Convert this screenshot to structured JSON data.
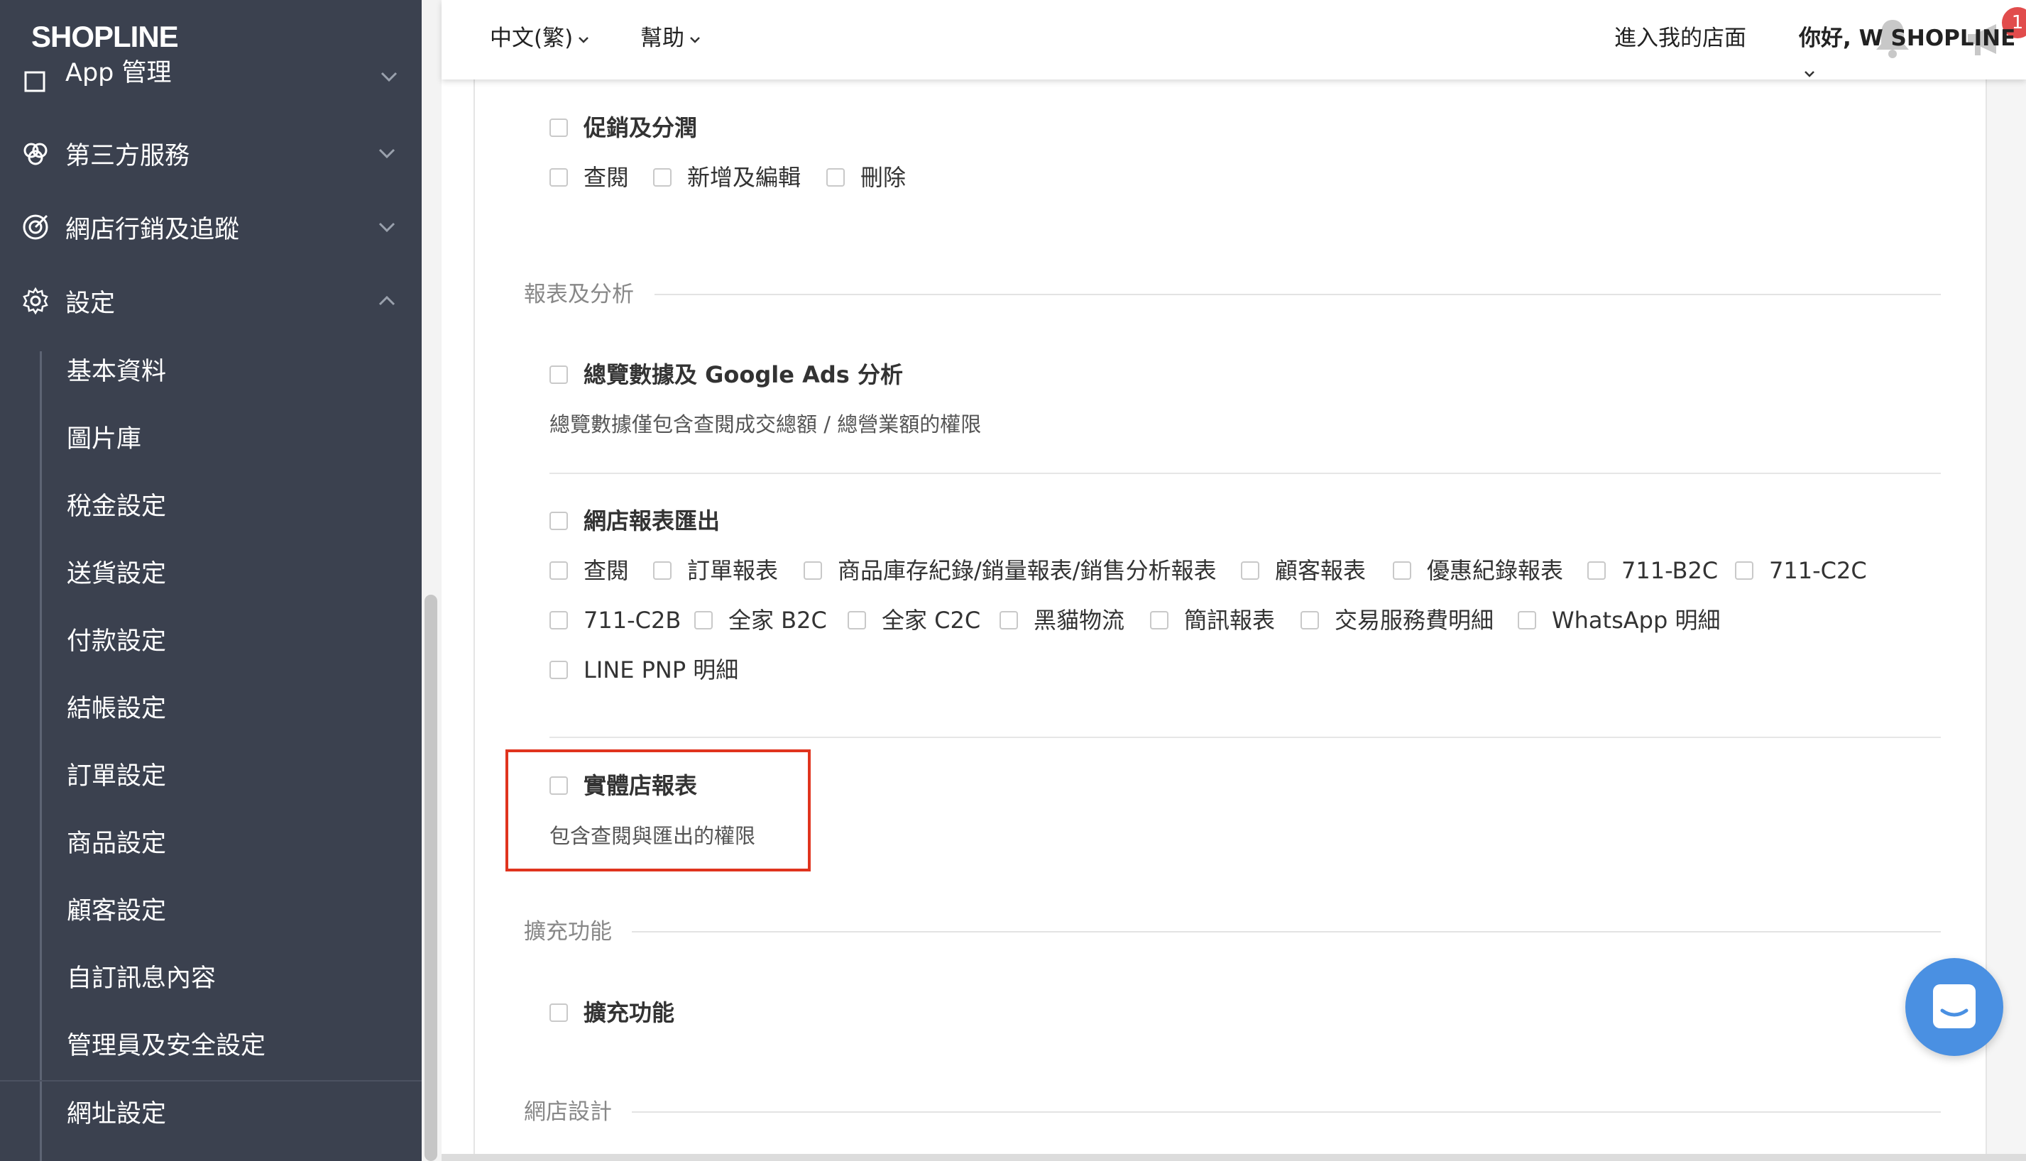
{
  "sidebar": {
    "logo": "SHOPLINE",
    "top_partial_item": "App 管理",
    "items": [
      {
        "label": "第三方服務",
        "icon": "puzzle-icon",
        "expanded": false
      },
      {
        "label": "網店行銷及追蹤",
        "icon": "target-icon",
        "expanded": false
      },
      {
        "label": "設定",
        "icon": "gear-icon",
        "expanded": true
      }
    ],
    "settings_sub_items": [
      "基本資料",
      "圖片庫",
      "稅金設定",
      "送貨設定",
      "付款設定",
      "結帳設定",
      "訂單設定",
      "商品設定",
      "顧客設定",
      "自訂訊息內容",
      "管理員及安全設定",
      "網址設定"
    ]
  },
  "topbar": {
    "language": "中文(繁)",
    "help": "幫助",
    "notification_badge": "1",
    "enter_store": "進入我的店面",
    "greeting": "你好, W SHOPLINE"
  },
  "permissions": {
    "promotions": {
      "title": "促銷及分潤",
      "options": [
        "查閱",
        "新增及編輯",
        "刪除"
      ]
    },
    "reports_section_title": "報表及分析",
    "overview": {
      "title": "總覽數據及 Google Ads 分析",
      "description": "總覽數據僅包含查閱成交總額 / 總營業額的權限"
    },
    "store_reports": {
      "title": "網店報表匯出",
      "options": [
        "查閱",
        "訂單報表",
        "商品庫存紀錄/銷量報表/銷售分析報表",
        "顧客報表",
        "優惠紀錄報表",
        "711-B2C",
        "711-C2C",
        "711-C2B",
        "全家 B2C",
        "全家 C2C",
        "黑貓物流",
        "簡訊報表",
        "交易服務費明細",
        "WhatsApp 明細",
        "LINE PNP 明細"
      ]
    },
    "retail_report": {
      "title": "實體店報表",
      "description": "包含查閱與匯出的權限"
    },
    "extensions_section_title": "擴充功能",
    "extensions": {
      "title": "擴充功能"
    },
    "store_design_section_title": "網店設計"
  },
  "colors": {
    "sidebar_bg": "#3b414f",
    "highlight_border": "#e0341e",
    "badge": "#e14c4c",
    "chat_button": "#4a90e2"
  }
}
